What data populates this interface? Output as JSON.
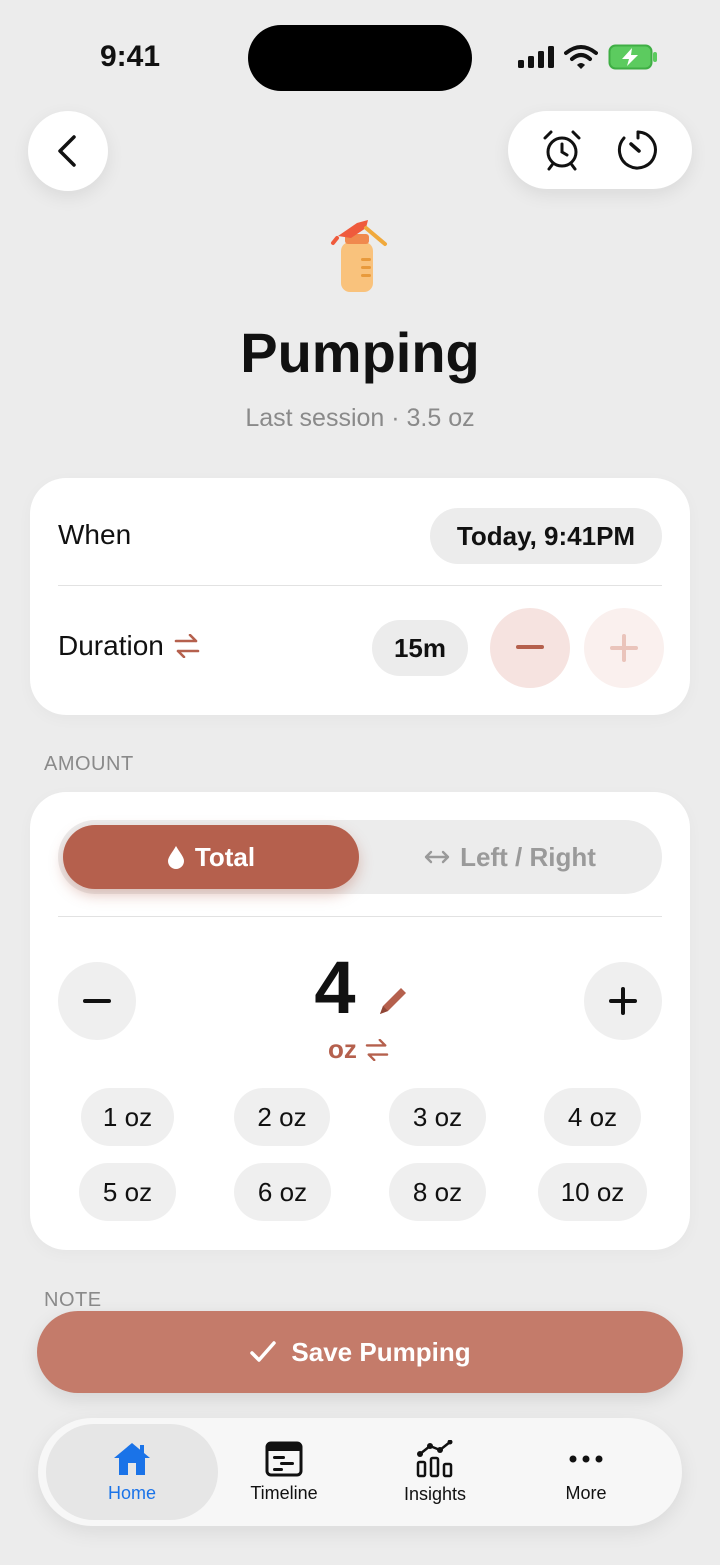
{
  "status": {
    "time": "9:41"
  },
  "header": {
    "title": "Pumping",
    "subtitle": "Last session · 3.5 oz",
    "icon": "breast-pump-icon"
  },
  "toolbar": {
    "icons": [
      "back-icon",
      "alarm-icon",
      "timer-icon"
    ]
  },
  "details": {
    "when_label": "When",
    "when_value": "Today, 9:41PM",
    "duration_label": "Duration",
    "duration_value": "15m"
  },
  "amount": {
    "section_label": "AMOUNT",
    "modes": [
      "Total",
      "Left / Right"
    ],
    "selected_mode": "Total",
    "value": "4",
    "unit": "oz",
    "presets": [
      "1 oz",
      "2 oz",
      "3 oz",
      "4 oz",
      "5 oz",
      "6 oz",
      "8 oz",
      "10 oz"
    ]
  },
  "note": {
    "section_label": "NOTE"
  },
  "save": {
    "label": "Save Pumping"
  },
  "tabs": [
    {
      "label": "Home",
      "icon": "home-icon",
      "active": true
    },
    {
      "label": "Timeline",
      "icon": "timeline-icon",
      "active": false
    },
    {
      "label": "Insights",
      "icon": "insights-icon",
      "active": false
    },
    {
      "label": "More",
      "icon": "more-icon",
      "active": false
    }
  ],
  "colors": {
    "accent": "#b5604d",
    "active_tab": "#1a73e8",
    "background": "#ececec"
  }
}
